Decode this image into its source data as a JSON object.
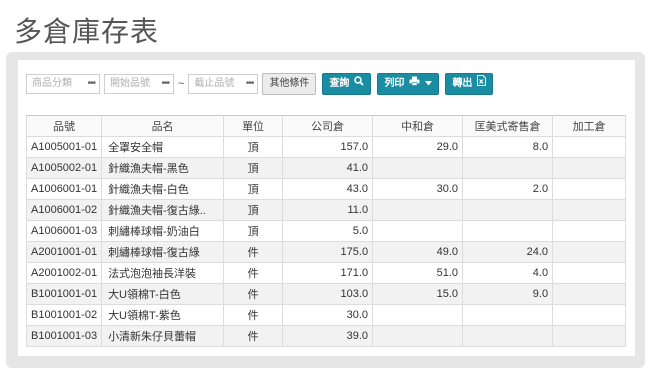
{
  "title": "多倉庫存表",
  "filters": {
    "category_placeholder": "商品分類",
    "from_placeholder": "開始品號",
    "range_sep": "~",
    "to_placeholder": "截止品號",
    "more_label": "其他條件"
  },
  "actions": {
    "query_label": "查詢",
    "print_label": "列印",
    "export_label": "轉出"
  },
  "table": {
    "headers": [
      "品號",
      "品名",
      "單位",
      "公司倉",
      "中和倉",
      "匡美式寄售倉",
      "加工倉"
    ],
    "rows": [
      [
        "A1005001-01",
        "全罩安全帽",
        "頂",
        "157.0",
        "29.0",
        "8.0",
        ""
      ],
      [
        "A1005002-01",
        "針織漁夫帽-黑色",
        "頂",
        "41.0",
        "",
        "",
        ""
      ],
      [
        "A1006001-01",
        "針織漁夫帽-白色",
        "頂",
        "43.0",
        "30.0",
        "2.0",
        ""
      ],
      [
        "A1006001-02",
        "針織漁夫帽-復古綠..",
        "頂",
        "11.0",
        "",
        "",
        ""
      ],
      [
        "A1006001-03",
        "刺繡棒球帽-奶油白",
        "頂",
        "5.0",
        "",
        "",
        ""
      ],
      [
        "A2001001-01",
        "刺繡棒球帽-復古綠",
        "件",
        "175.0",
        "49.0",
        "24.0",
        ""
      ],
      [
        "A2001002-01",
        "法式泡泡袖長洋裝",
        "件",
        "171.0",
        "51.0",
        "4.0",
        ""
      ],
      [
        "B1001001-01",
        "大U領棉T-白色",
        "件",
        "103.0",
        "15.0",
        "9.0",
        ""
      ],
      [
        "B1001001-02",
        "大U領棉T-紫色",
        "件",
        "30.0",
        "",
        "",
        ""
      ],
      [
        "B1001001-03",
        "小清新朱仔貝蕾帽",
        "件",
        "39.0",
        "",
        "",
        ""
      ]
    ]
  }
}
